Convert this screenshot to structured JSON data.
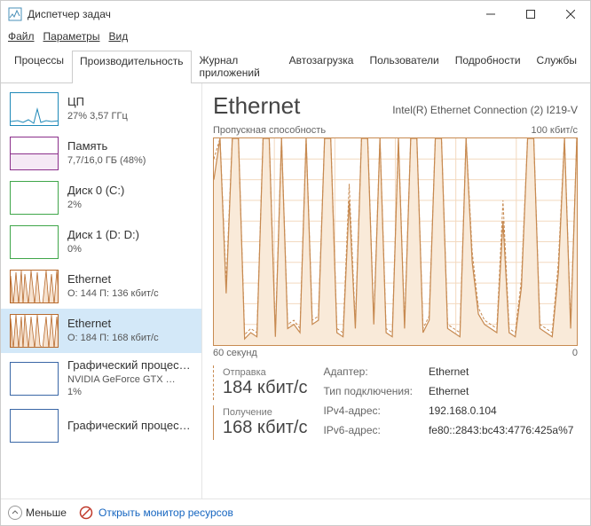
{
  "window": {
    "title": "Диспетчер задач"
  },
  "menu": {
    "file": "Файл",
    "options": "Параметры",
    "view": "Вид"
  },
  "tabs": [
    {
      "label": "Процессы"
    },
    {
      "label": "Производительность"
    },
    {
      "label": "Журнал приложений"
    },
    {
      "label": "Автозагрузка"
    },
    {
      "label": "Пользователи"
    },
    {
      "label": "Подробности"
    },
    {
      "label": "Службы"
    }
  ],
  "sidebar": [
    {
      "title": "ЦП",
      "sub": "27% 3,57 ГГц",
      "kind": "cpu"
    },
    {
      "title": "Память",
      "sub": "7,7/16,0 ГБ (48%)",
      "kind": "mem"
    },
    {
      "title": "Диск 0 (C:)",
      "sub": "2%",
      "kind": "disk"
    },
    {
      "title": "Диск 1 (D: D:)",
      "sub": "0%",
      "kind": "disk"
    },
    {
      "title": "Ethernet",
      "sub": "О: 144 П: 136 кбит/с",
      "kind": "eth"
    },
    {
      "title": "Ethernet",
      "sub": "О: 184 П: 168 кбит/с",
      "kind": "eth"
    },
    {
      "title": "Графический процессор",
      "sub": "NVIDIA GeForce GTX …",
      "sub2": "1%",
      "kind": "gpu"
    },
    {
      "title": "Графический процессор",
      "sub": "",
      "kind": "gpu"
    }
  ],
  "main": {
    "title": "Ethernet",
    "adapter": "Intel(R) Ethernet Connection (2) I219-V",
    "chart_title_left": "Пропускная способность",
    "chart_title_right": "100 кбит/с",
    "chart_axis_left": "60 секунд",
    "chart_axis_right": "0",
    "send": {
      "label": "Отправка",
      "value": "184 кбит/с"
    },
    "recv": {
      "label": "Получение",
      "value": "168 кбит/с"
    },
    "props": {
      "adapter_k": "Адаптер:",
      "adapter_v": "Ethernet",
      "conn_k": "Тип подключения:",
      "conn_v": "Ethernet",
      "ipv4_k": "IPv4-адрес:",
      "ipv4_v": "192.168.0.104",
      "ipv6_k": "IPv6-адрес:",
      "ipv6_v": "fe80::2843:bc43:4776:425a%7"
    }
  },
  "footer": {
    "less": "Меньше",
    "rmon": "Открыть монитор ресурсов"
  },
  "chart_data": {
    "type": "line",
    "title": "Пропускная способность",
    "xlabel": "60 секунд",
    "ylabel": "",
    "ylim": [
      0,
      100
    ],
    "x": [
      0,
      1,
      2,
      3,
      4,
      5,
      6,
      7,
      8,
      9,
      10,
      11,
      12,
      13,
      14,
      15,
      16,
      17,
      18,
      19,
      20,
      21,
      22,
      23,
      24,
      25,
      26,
      27,
      28,
      29,
      30,
      31,
      32,
      33,
      34,
      35,
      36,
      37,
      38,
      39,
      40,
      41,
      42,
      43,
      44,
      45,
      46,
      47,
      48,
      49,
      50,
      51,
      52,
      53,
      54,
      55,
      56,
      57,
      58,
      59
    ],
    "series": [
      {
        "name": "Отправка (кбит/с)",
        "style": "dashed",
        "values": [
          90,
          100,
          30,
          100,
          100,
          5,
          8,
          6,
          100,
          100,
          6,
          100,
          10,
          12,
          8,
          100,
          12,
          14,
          100,
          100,
          8,
          6,
          78,
          10,
          100,
          100,
          12,
          100,
          8,
          6,
          100,
          10,
          100,
          100,
          8,
          14,
          100,
          100,
          10,
          8,
          6,
          100,
          45,
          18,
          12,
          10,
          8,
          70,
          8,
          6,
          32,
          100,
          100,
          10,
          8,
          6,
          40,
          100,
          10,
          100
        ]
      },
      {
        "name": "Получение (кбит/с)",
        "style": "solid",
        "values": [
          80,
          100,
          25,
          100,
          100,
          3,
          6,
          4,
          100,
          100,
          4,
          100,
          8,
          10,
          6,
          100,
          10,
          12,
          100,
          100,
          6,
          4,
          70,
          8,
          100,
          100,
          10,
          100,
          6,
          4,
          100,
          8,
          100,
          100,
          6,
          12,
          100,
          100,
          8,
          6,
          4,
          100,
          40,
          15,
          10,
          8,
          6,
          60,
          6,
          4,
          28,
          100,
          100,
          8,
          6,
          4,
          35,
          100,
          8,
          100
        ]
      }
    ]
  }
}
